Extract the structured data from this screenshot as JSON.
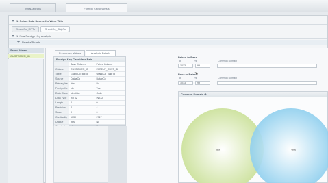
{
  "top_tabs": [
    "InitialObjectIs",
    "Foreign Key Analysis"
  ],
  "section_header": "1: Select Data Source for Work With",
  "source_tabs": [
    "GrandCo_RPTo",
    "GrandCo_ShipTo"
  ],
  "breadcrumb": "1: New Foreign Key Analysis",
  "results_label": "Results/Details",
  "select_views": {
    "title": "Select Views",
    "item": "CUSTOMER_ID"
  },
  "sub_tabs": [
    "Frequency Values",
    "Analysis Details"
  ],
  "candidate_pair": {
    "title": "Foreign Key Candidate Pair",
    "headers": [
      "",
      "Base Column",
      "Paired Column"
    ],
    "rows": [
      [
        "Column",
        "CUSTOMER_ID",
        "PARENT_CUST_ID"
      ],
      [
        "Table",
        "GrandCo_BillTo",
        "GrandCo_ShipTo"
      ],
      [
        "Source",
        "DataeCo",
        "DataeCo"
      ],
      [
        "Primary Ke",
        "Yes",
        "No"
      ],
      [
        "Foreign Ke",
        "No",
        "Yes"
      ],
      [
        "Data Class",
        "Identifier",
        "Code"
      ],
      [
        "Data Type",
        "INT32",
        "INT32"
      ],
      [
        "Length",
        "0",
        "0"
      ],
      [
        "Precision",
        "4",
        "4"
      ],
      [
        "Scale",
        "0",
        "0"
      ],
      [
        "Cardinality",
        "1030",
        "2717"
      ],
      [
        "Unique",
        "Yes",
        "No"
      ],
      [
        "Constant",
        "No",
        "No"
      ],
      [
        "Definition",
        "No",
        "No"
      ]
    ]
  },
  "paired_to_base": {
    "title": "Paired to Base",
    "col_headers": [
      "#",
      "%",
      "Common Domain"
    ],
    "values": [
      "1013",
      "99"
    ]
  },
  "base_to_paired": {
    "title": "Base to Paired",
    "col_headers": [
      "#",
      "%",
      "Common Domain"
    ],
    "values": [
      "1013",
      "99"
    ]
  },
  "common_domain": {
    "title": "Common Domain ⊕",
    "left_label": "%%",
    "right_label": "%%"
  },
  "colors": {
    "left_circle": "#cfe3a2",
    "right_circle": "#8fcfee",
    "select_item_bg": "#e9f3c8"
  }
}
